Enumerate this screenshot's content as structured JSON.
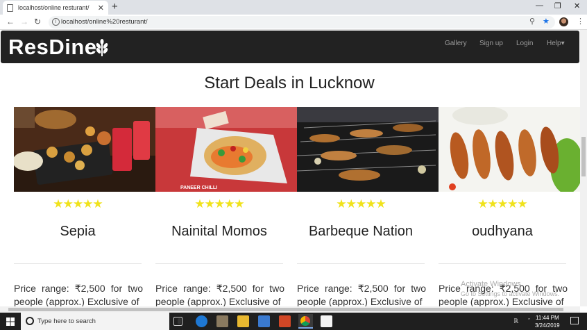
{
  "browser": {
    "tab_title": "localhost/online resturant/",
    "new_tab": "+",
    "close_tab": "✕",
    "url": "localhost/online%20resturant/",
    "win_min": "—",
    "win_max": "❐",
    "win_close": "✕"
  },
  "navbar": {
    "brand": "ResDine",
    "links": [
      "Gallery",
      "Sign up",
      "Login",
      "Help▾"
    ]
  },
  "main": {
    "heading": "Start Deals in Lucknow",
    "restaurants": [
      {
        "name": "Sepia",
        "rating": 5,
        "stars": "★★★★★",
        "description": "Price range: ₹2,500 for two people (approx.) Exclusive of",
        "image_caption": ""
      },
      {
        "name": "Nainital Momos",
        "rating": 5,
        "stars": "★★★★★",
        "description": "Price range: ₹2,500 for two people (approx.) Exclusive of",
        "image_caption": "PANEER CHILLI"
      },
      {
        "name": "Barbeque Nation",
        "rating": 5,
        "stars": "★★★★★",
        "description": "Price range: ₹2,500 for two people (approx.) Exclusive of",
        "image_caption": ""
      },
      {
        "name": "oudhyana",
        "rating": 5,
        "stars": "★★★★★",
        "description": "Price range: ₹2,500 for two people (approx.) Exclusive of",
        "image_caption": ""
      }
    ]
  },
  "overlay": {
    "activate_title": "Activate Windows",
    "activate_sub": "Go to Settings to activate Windows."
  },
  "taskbar": {
    "search_placeholder": "Type here to search",
    "time": "11:44 PM",
    "date": "3/24/2019"
  },
  "colors": {
    "navbar_bg": "#222222",
    "star": "#f0e21a",
    "taskbar_bg": "#1f1f1f"
  }
}
